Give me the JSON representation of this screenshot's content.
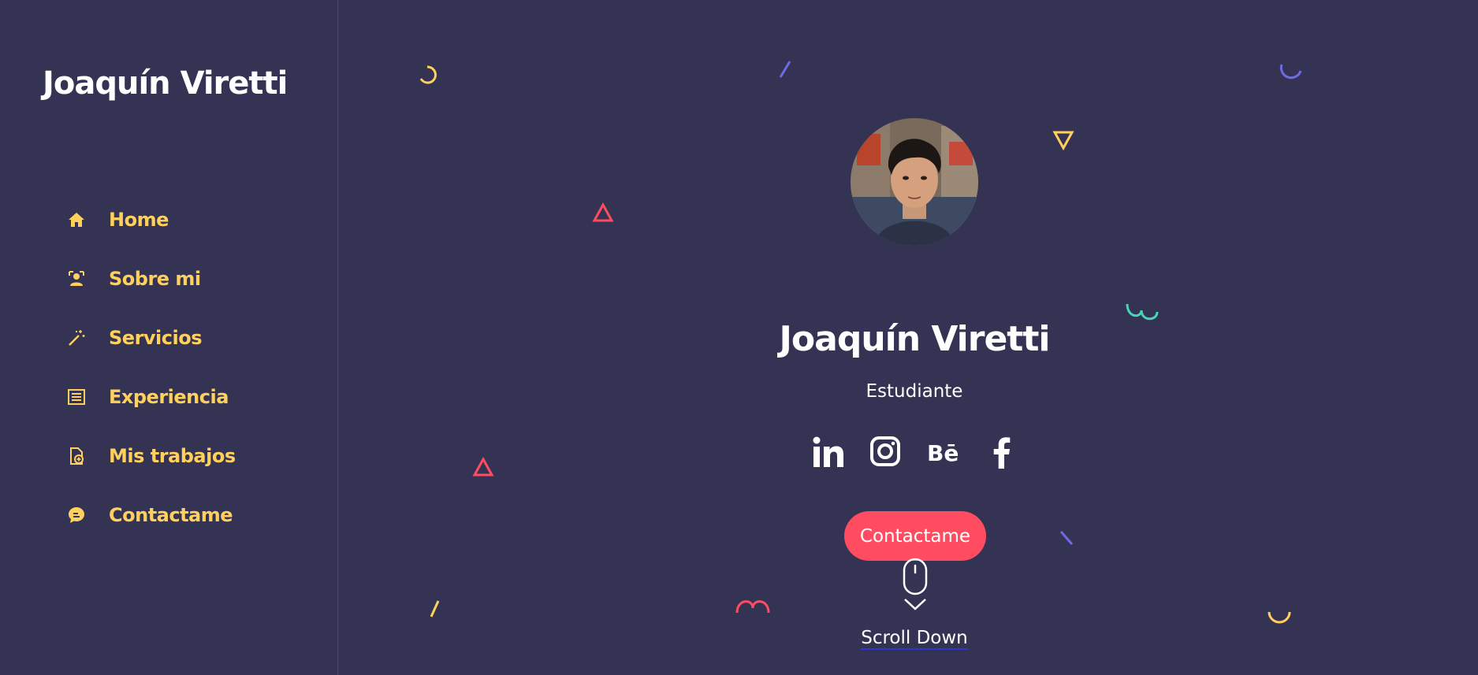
{
  "sidebar": {
    "brand": "Joaquín Viretti",
    "items": [
      {
        "label": "Home",
        "icon": "home-icon"
      },
      {
        "label": "Sobre mi",
        "icon": "user-icon"
      },
      {
        "label": "Servicios",
        "icon": "magic-wand-icon"
      },
      {
        "label": "Experiencia",
        "icon": "list-icon"
      },
      {
        "label": "Mis trabajos",
        "icon": "file-add-icon"
      },
      {
        "label": "Contactame",
        "icon": "chat-icon"
      }
    ]
  },
  "hero": {
    "name": "Joaquín Viretti",
    "role": "Estudiante",
    "cta_label": "Contactame",
    "scroll_label": "Scroll Down",
    "social": [
      "linkedin-icon",
      "instagram-icon",
      "behance-icon",
      "facebook-icon"
    ]
  },
  "colors": {
    "background": "#353353",
    "accent_yellow": "#ffd15c",
    "accent_red": "#ff4c60",
    "accent_purple": "#6c6ce5",
    "accent_teal": "#44d7b6"
  }
}
